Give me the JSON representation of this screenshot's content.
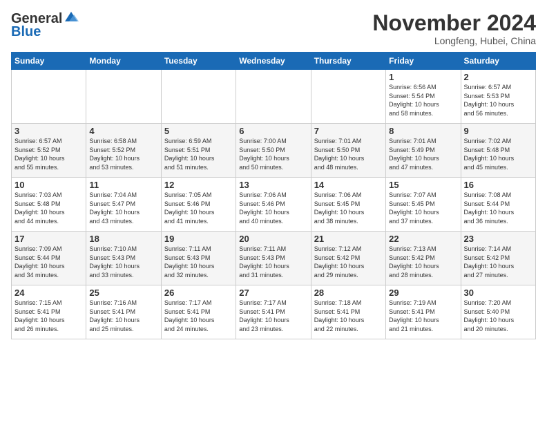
{
  "logo": {
    "line1": "General",
    "line2": "Blue"
  },
  "title": "November 2024",
  "subtitle": "Longfeng, Hubei, China",
  "header": {
    "days": [
      "Sunday",
      "Monday",
      "Tuesday",
      "Wednesday",
      "Thursday",
      "Friday",
      "Saturday"
    ]
  },
  "weeks": [
    {
      "cells": [
        {
          "day": "",
          "text": ""
        },
        {
          "day": "",
          "text": ""
        },
        {
          "day": "",
          "text": ""
        },
        {
          "day": "",
          "text": ""
        },
        {
          "day": "",
          "text": ""
        },
        {
          "day": "1",
          "text": "Sunrise: 6:56 AM\nSunset: 5:54 PM\nDaylight: 10 hours\nand 58 minutes."
        },
        {
          "day": "2",
          "text": "Sunrise: 6:57 AM\nSunset: 5:53 PM\nDaylight: 10 hours\nand 56 minutes."
        }
      ]
    },
    {
      "cells": [
        {
          "day": "3",
          "text": "Sunrise: 6:57 AM\nSunset: 5:52 PM\nDaylight: 10 hours\nand 55 minutes."
        },
        {
          "day": "4",
          "text": "Sunrise: 6:58 AM\nSunset: 5:52 PM\nDaylight: 10 hours\nand 53 minutes."
        },
        {
          "day": "5",
          "text": "Sunrise: 6:59 AM\nSunset: 5:51 PM\nDaylight: 10 hours\nand 51 minutes."
        },
        {
          "day": "6",
          "text": "Sunrise: 7:00 AM\nSunset: 5:50 PM\nDaylight: 10 hours\nand 50 minutes."
        },
        {
          "day": "7",
          "text": "Sunrise: 7:01 AM\nSunset: 5:50 PM\nDaylight: 10 hours\nand 48 minutes."
        },
        {
          "day": "8",
          "text": "Sunrise: 7:01 AM\nSunset: 5:49 PM\nDaylight: 10 hours\nand 47 minutes."
        },
        {
          "day": "9",
          "text": "Sunrise: 7:02 AM\nSunset: 5:48 PM\nDaylight: 10 hours\nand 45 minutes."
        }
      ]
    },
    {
      "cells": [
        {
          "day": "10",
          "text": "Sunrise: 7:03 AM\nSunset: 5:48 PM\nDaylight: 10 hours\nand 44 minutes."
        },
        {
          "day": "11",
          "text": "Sunrise: 7:04 AM\nSunset: 5:47 PM\nDaylight: 10 hours\nand 43 minutes."
        },
        {
          "day": "12",
          "text": "Sunrise: 7:05 AM\nSunset: 5:46 PM\nDaylight: 10 hours\nand 41 minutes."
        },
        {
          "day": "13",
          "text": "Sunrise: 7:06 AM\nSunset: 5:46 PM\nDaylight: 10 hours\nand 40 minutes."
        },
        {
          "day": "14",
          "text": "Sunrise: 7:06 AM\nSunset: 5:45 PM\nDaylight: 10 hours\nand 38 minutes."
        },
        {
          "day": "15",
          "text": "Sunrise: 7:07 AM\nSunset: 5:45 PM\nDaylight: 10 hours\nand 37 minutes."
        },
        {
          "day": "16",
          "text": "Sunrise: 7:08 AM\nSunset: 5:44 PM\nDaylight: 10 hours\nand 36 minutes."
        }
      ]
    },
    {
      "cells": [
        {
          "day": "17",
          "text": "Sunrise: 7:09 AM\nSunset: 5:44 PM\nDaylight: 10 hours\nand 34 minutes."
        },
        {
          "day": "18",
          "text": "Sunrise: 7:10 AM\nSunset: 5:43 PM\nDaylight: 10 hours\nand 33 minutes."
        },
        {
          "day": "19",
          "text": "Sunrise: 7:11 AM\nSunset: 5:43 PM\nDaylight: 10 hours\nand 32 minutes."
        },
        {
          "day": "20",
          "text": "Sunrise: 7:11 AM\nSunset: 5:43 PM\nDaylight: 10 hours\nand 31 minutes."
        },
        {
          "day": "21",
          "text": "Sunrise: 7:12 AM\nSunset: 5:42 PM\nDaylight: 10 hours\nand 29 minutes."
        },
        {
          "day": "22",
          "text": "Sunrise: 7:13 AM\nSunset: 5:42 PM\nDaylight: 10 hours\nand 28 minutes."
        },
        {
          "day": "23",
          "text": "Sunrise: 7:14 AM\nSunset: 5:42 PM\nDaylight: 10 hours\nand 27 minutes."
        }
      ]
    },
    {
      "cells": [
        {
          "day": "24",
          "text": "Sunrise: 7:15 AM\nSunset: 5:41 PM\nDaylight: 10 hours\nand 26 minutes."
        },
        {
          "day": "25",
          "text": "Sunrise: 7:16 AM\nSunset: 5:41 PM\nDaylight: 10 hours\nand 25 minutes."
        },
        {
          "day": "26",
          "text": "Sunrise: 7:17 AM\nSunset: 5:41 PM\nDaylight: 10 hours\nand 24 minutes."
        },
        {
          "day": "27",
          "text": "Sunrise: 7:17 AM\nSunset: 5:41 PM\nDaylight: 10 hours\nand 23 minutes."
        },
        {
          "day": "28",
          "text": "Sunrise: 7:18 AM\nSunset: 5:41 PM\nDaylight: 10 hours\nand 22 minutes."
        },
        {
          "day": "29",
          "text": "Sunrise: 7:19 AM\nSunset: 5:41 PM\nDaylight: 10 hours\nand 21 minutes."
        },
        {
          "day": "30",
          "text": "Sunrise: 7:20 AM\nSunset: 5:40 PM\nDaylight: 10 hours\nand 20 minutes."
        }
      ]
    }
  ]
}
